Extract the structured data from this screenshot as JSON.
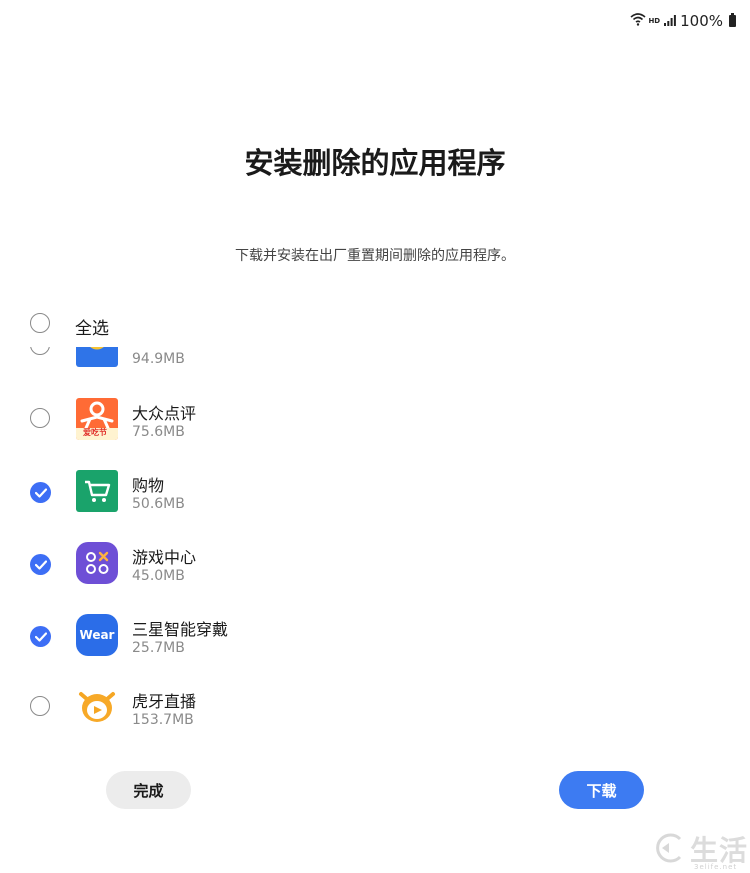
{
  "status_bar": {
    "wifi_icon": "wifi-icon",
    "hd_label": "HD",
    "signal_icon": "signal-icon",
    "battery_text": "100%",
    "battery_icon": "battery-icon"
  },
  "page": {
    "title": "安装删除的应用程序",
    "subtitle": "下载并安装在出厂重置期间删除的应用程序。"
  },
  "select_all": {
    "label": "全选",
    "checked": false
  },
  "apps": [
    {
      "name": "",
      "size": "94.9MB",
      "checked": false,
      "icon": "partial-app-icon"
    },
    {
      "name": "大众点评",
      "size": "75.6MB",
      "checked": false,
      "icon": "dianping-icon",
      "badge": "爱吃节"
    },
    {
      "name": "购物",
      "size": "50.6MB",
      "checked": true,
      "icon": "shopping-cart-icon"
    },
    {
      "name": "游戏中心",
      "size": "45.0MB",
      "checked": true,
      "icon": "game-center-icon"
    },
    {
      "name": "三星智能穿戴",
      "size": "25.7MB",
      "checked": true,
      "icon": "wear-icon",
      "icon_text": "Wear"
    },
    {
      "name": "虎牙直播",
      "size": "153.7MB",
      "checked": false,
      "icon": "huya-icon"
    }
  ],
  "buttons": {
    "done": "完成",
    "download": "下载"
  },
  "watermark": {
    "text": "生活",
    "url": "3elife.net"
  },
  "colors": {
    "accent": "#3d6ef5",
    "download_bg": "#3d7bf2",
    "done_bg": "#ececec"
  }
}
